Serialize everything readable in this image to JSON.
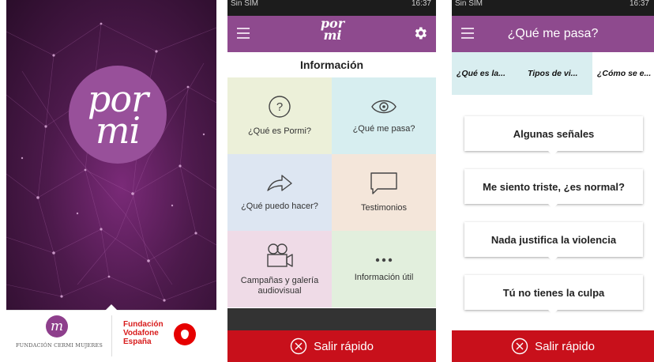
{
  "splash": {
    "logo_line1": "por",
    "logo_line2": "mi",
    "cermi_monogram": "m",
    "cermi_name": "FUNDACIÓN CERMI MUJERES",
    "vodafone_line1": "Fundación",
    "vodafone_line2": "Vodafone",
    "vodafone_line3": "España",
    "colors": {
      "background": "#4d1a4c",
      "logo_circle": "#98509a",
      "vodafone_red": "#e60000"
    }
  },
  "screen2": {
    "status_left": "Sin SIM",
    "status_right": "16:37",
    "app_logo_line1": "por",
    "app_logo_line2": "mi",
    "section_title": "Información",
    "tiles": [
      {
        "label": "¿Qué es Pormi?",
        "icon": "question-circle-icon",
        "color": "#ecf0d9"
      },
      {
        "label": "¿Qué me pasa?",
        "icon": "eye-icon",
        "color": "#d7eef0"
      },
      {
        "label": "¿Qué puedo hacer?",
        "icon": "arrow-right-icon",
        "color": "#dde6f2"
      },
      {
        "label": "Testimonios",
        "icon": "speech-bubble-icon",
        "color": "#f4e6da"
      },
      {
        "label": "Campañas y galería audiovisual",
        "icon": "video-camera-icon",
        "color": "#efdbe7"
      },
      {
        "label": "Información útil",
        "icon": "more-dots-icon",
        "color": "#e2efdd"
      }
    ],
    "exit_label": "Salir rápido",
    "colors": {
      "appbar": "#8e4a8e",
      "exit": "#c8101b"
    }
  },
  "screen3": {
    "status_left": "Sin SIM",
    "status_right": "16:37",
    "title": "¿Qué me pasa?",
    "tabs": [
      "¿Qué es la...",
      "Tipos de vi...",
      "¿Cómo se e..."
    ],
    "active_tab": 2,
    "cards": [
      "Algunas señales",
      "Me siento triste, ¿es normal?",
      "Nada justifica la violencia",
      "Tú no tienes la culpa"
    ],
    "exit_label": "Salir rápido"
  }
}
